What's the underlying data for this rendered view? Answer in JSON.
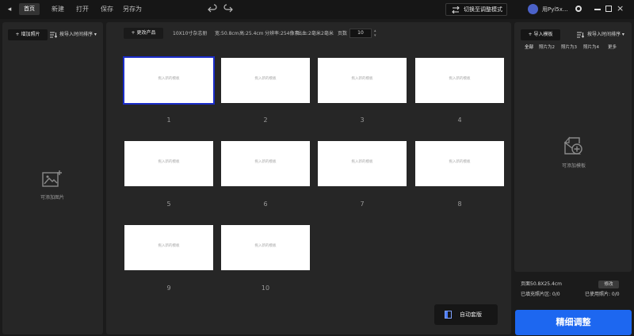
{
  "topbar": {
    "back_glyph": "◂",
    "home": "首页",
    "menu": [
      "新建",
      "打开",
      "保存",
      "另存为"
    ],
    "switch_label": "切换至调整模式",
    "username": "用Pyl5x...",
    "close_glyph": "×"
  },
  "left": {
    "add_photo": "+ 增加照片",
    "sort": "按导入时间排序 ▾",
    "empty_label": "可添加图片"
  },
  "center": {
    "change_product": "+ 更改产品",
    "product_name": "10X10寸杂志册",
    "spec_width": "宽:50.8cm",
    "spec_height": "高:25.4cm",
    "spec_resolution": "分辨率:254像素",
    "spec_bleed": "出血:2毫米",
    "spec_bleed2": "2毫米",
    "pages_label": "页数",
    "pages_value": "10",
    "spin_up": "▴",
    "spin_down": "▾",
    "placeholder": "拖入新的模板",
    "page_numbers": [
      "1",
      "2",
      "3",
      "4",
      "5",
      "6",
      "7",
      "8",
      "9",
      "10"
    ],
    "auto_layout": "自动套版"
  },
  "right": {
    "import_template": "+ 导入模板",
    "sort": "按导入时间排序 ▾",
    "tabs": [
      "全部",
      "照片为2",
      "照片为3",
      "照片为4",
      "更多"
    ],
    "empty_label": "可添加模板",
    "page_size": "页面50.8X25.4cm",
    "modify": "修改",
    "filled": "已填充照片区: 0/0",
    "used": "已使用照片: 0/0",
    "fine_adjust": "精细调整"
  }
}
